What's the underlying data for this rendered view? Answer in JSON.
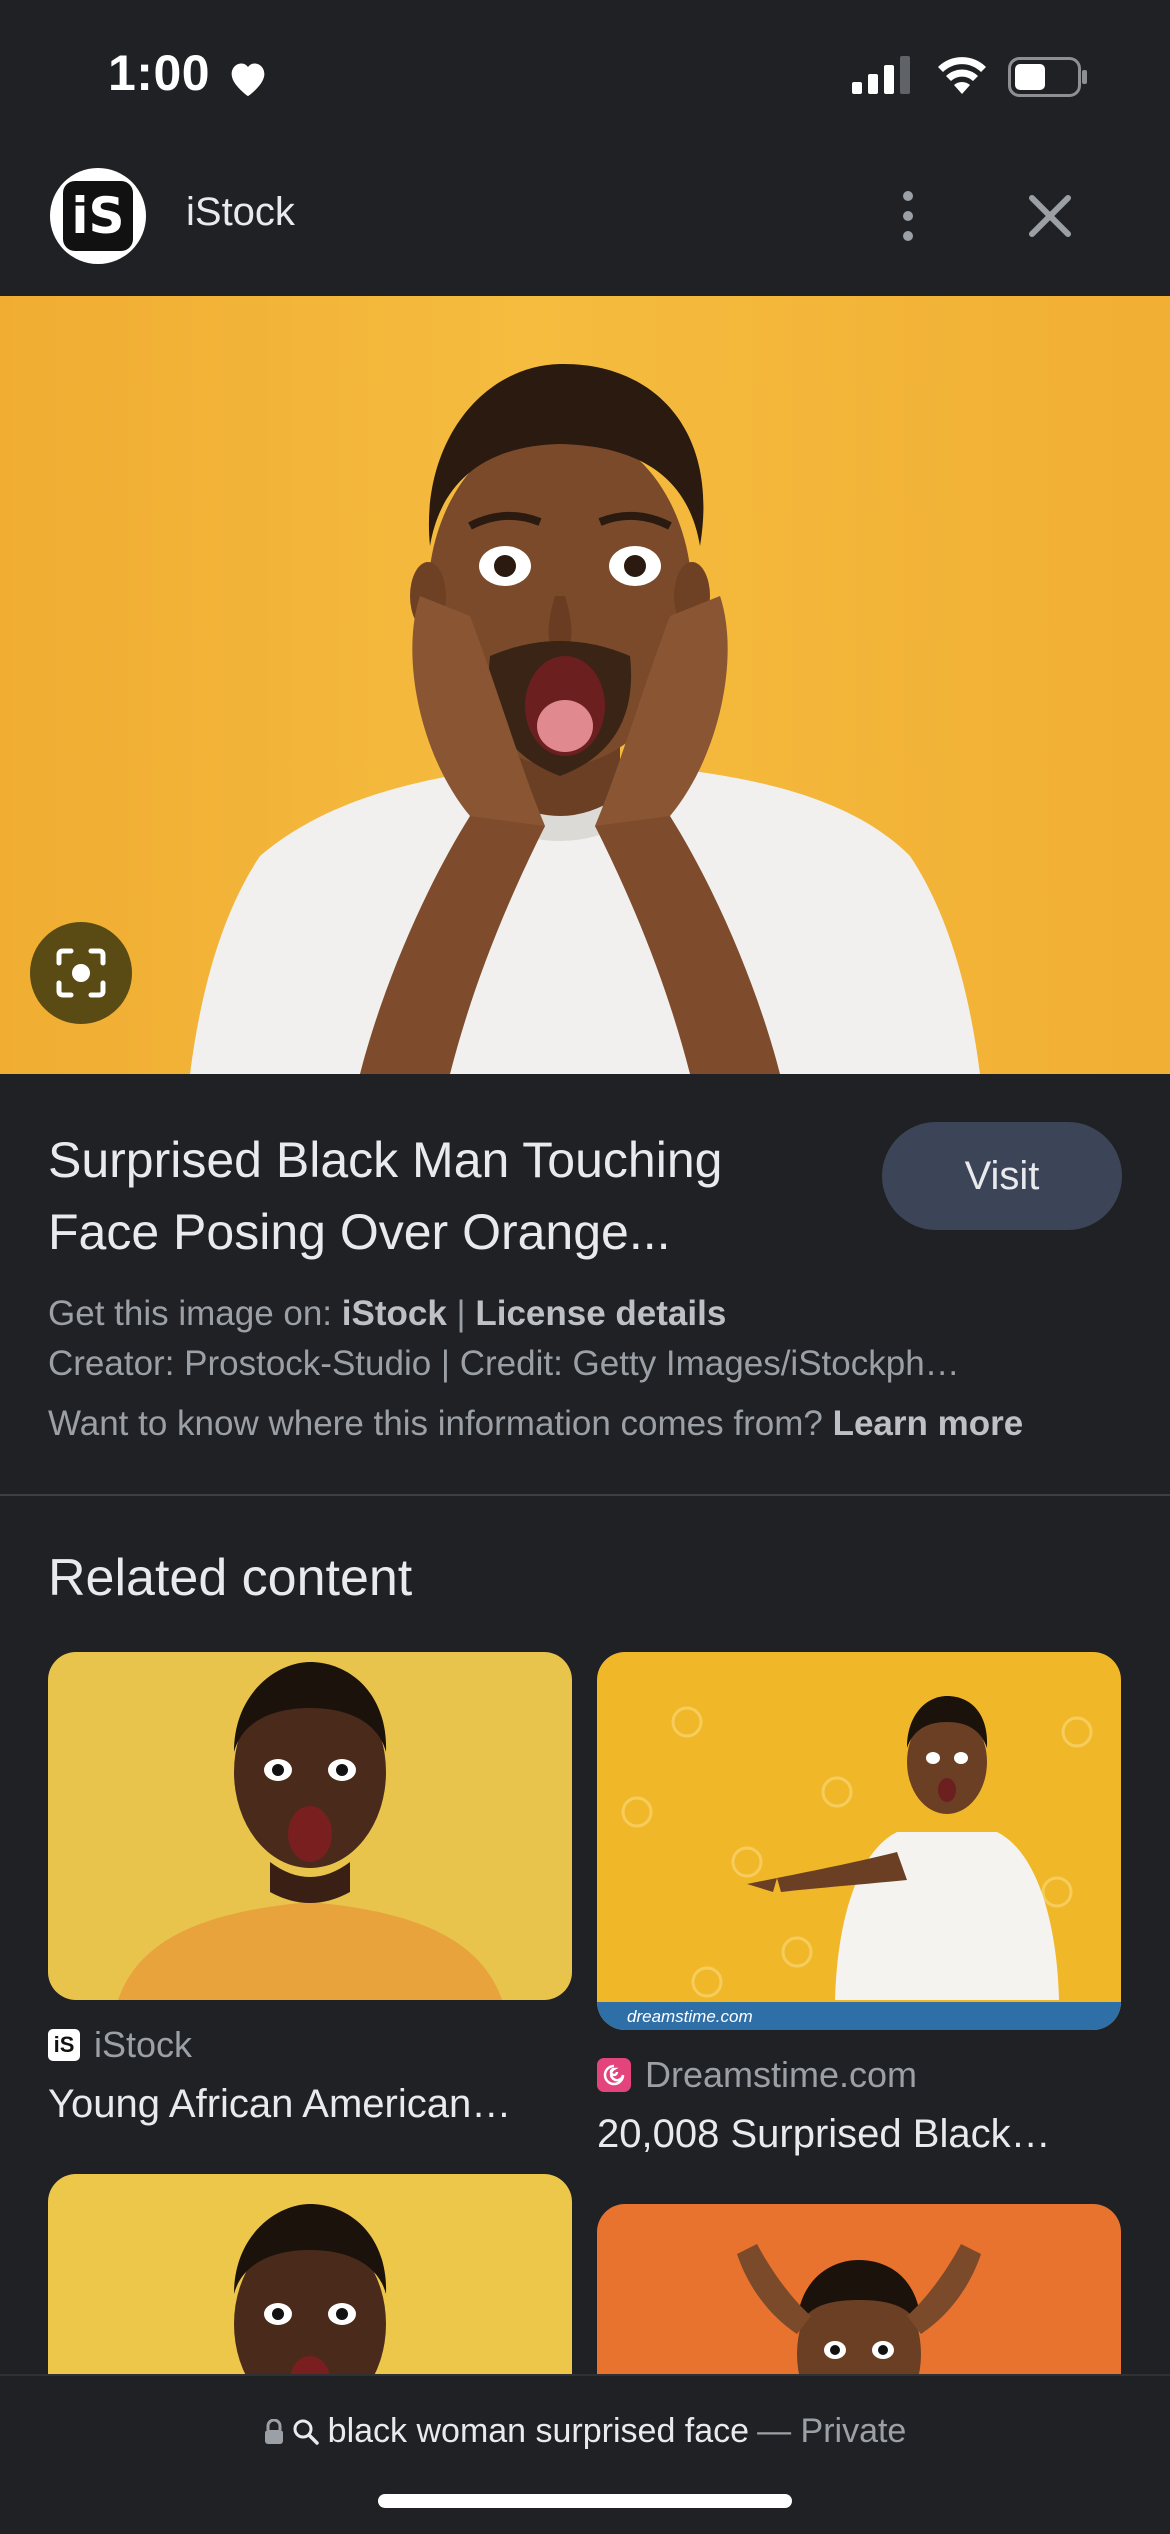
{
  "status": {
    "time": "1:00"
  },
  "header": {
    "logo_text": "iS",
    "site_name": "iStock"
  },
  "result": {
    "title_line1": "Surprised Black Man Touching",
    "title_line2": "Face Posing Over Orange...",
    "visit_label": "Visit",
    "get_image_prefix": "Get this image on: ",
    "get_image_source": "iStock",
    "separator": " | ",
    "license_label": "License details",
    "creator_line": "Creator: Prostock-Studio | Credit: Getty Images/iStockph…",
    "info_question": "Want to know where this information comes from? ",
    "learn_more_label": "Learn more"
  },
  "related": {
    "heading": "Related content",
    "cards": [
      {
        "source": "iStock",
        "title": "Young African American…",
        "source_icon": "istock-icon"
      },
      {
        "source": "Dreamstime.com",
        "title": "20,008 Surprised Black…",
        "source_icon": "dreamstime-icon",
        "watermark": "dreamstime.com"
      }
    ]
  },
  "bottom": {
    "query": "black woman surprised face",
    "privacy": "— Private"
  },
  "colors": {
    "background": "#202124",
    "visit_button": "#3c4457",
    "hero_background": "#f5bc3f"
  }
}
